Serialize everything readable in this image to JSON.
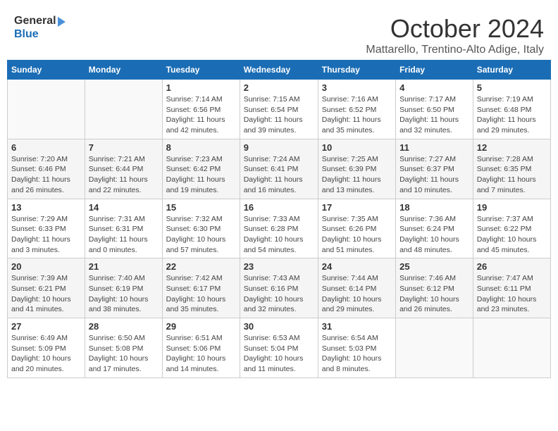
{
  "header": {
    "logo_general": "General",
    "logo_blue": "Blue",
    "month_title": "October 2024",
    "location": "Mattarello, Trentino-Alto Adige, Italy"
  },
  "days_of_week": [
    "Sunday",
    "Monday",
    "Tuesday",
    "Wednesday",
    "Thursday",
    "Friday",
    "Saturday"
  ],
  "weeks": [
    [
      {
        "day": "",
        "info": ""
      },
      {
        "day": "",
        "info": ""
      },
      {
        "day": "1",
        "info": "Sunrise: 7:14 AM\nSunset: 6:56 PM\nDaylight: 11 hours and 42 minutes."
      },
      {
        "day": "2",
        "info": "Sunrise: 7:15 AM\nSunset: 6:54 PM\nDaylight: 11 hours and 39 minutes."
      },
      {
        "day": "3",
        "info": "Sunrise: 7:16 AM\nSunset: 6:52 PM\nDaylight: 11 hours and 35 minutes."
      },
      {
        "day": "4",
        "info": "Sunrise: 7:17 AM\nSunset: 6:50 PM\nDaylight: 11 hours and 32 minutes."
      },
      {
        "day": "5",
        "info": "Sunrise: 7:19 AM\nSunset: 6:48 PM\nDaylight: 11 hours and 29 minutes."
      }
    ],
    [
      {
        "day": "6",
        "info": "Sunrise: 7:20 AM\nSunset: 6:46 PM\nDaylight: 11 hours and 26 minutes."
      },
      {
        "day": "7",
        "info": "Sunrise: 7:21 AM\nSunset: 6:44 PM\nDaylight: 11 hours and 22 minutes."
      },
      {
        "day": "8",
        "info": "Sunrise: 7:23 AM\nSunset: 6:42 PM\nDaylight: 11 hours and 19 minutes."
      },
      {
        "day": "9",
        "info": "Sunrise: 7:24 AM\nSunset: 6:41 PM\nDaylight: 11 hours and 16 minutes."
      },
      {
        "day": "10",
        "info": "Sunrise: 7:25 AM\nSunset: 6:39 PM\nDaylight: 11 hours and 13 minutes."
      },
      {
        "day": "11",
        "info": "Sunrise: 7:27 AM\nSunset: 6:37 PM\nDaylight: 11 hours and 10 minutes."
      },
      {
        "day": "12",
        "info": "Sunrise: 7:28 AM\nSunset: 6:35 PM\nDaylight: 11 hours and 7 minutes."
      }
    ],
    [
      {
        "day": "13",
        "info": "Sunrise: 7:29 AM\nSunset: 6:33 PM\nDaylight: 11 hours and 3 minutes."
      },
      {
        "day": "14",
        "info": "Sunrise: 7:31 AM\nSunset: 6:31 PM\nDaylight: 11 hours and 0 minutes."
      },
      {
        "day": "15",
        "info": "Sunrise: 7:32 AM\nSunset: 6:30 PM\nDaylight: 10 hours and 57 minutes."
      },
      {
        "day": "16",
        "info": "Sunrise: 7:33 AM\nSunset: 6:28 PM\nDaylight: 10 hours and 54 minutes."
      },
      {
        "day": "17",
        "info": "Sunrise: 7:35 AM\nSunset: 6:26 PM\nDaylight: 10 hours and 51 minutes."
      },
      {
        "day": "18",
        "info": "Sunrise: 7:36 AM\nSunset: 6:24 PM\nDaylight: 10 hours and 48 minutes."
      },
      {
        "day": "19",
        "info": "Sunrise: 7:37 AM\nSunset: 6:22 PM\nDaylight: 10 hours and 45 minutes."
      }
    ],
    [
      {
        "day": "20",
        "info": "Sunrise: 7:39 AM\nSunset: 6:21 PM\nDaylight: 10 hours and 41 minutes."
      },
      {
        "day": "21",
        "info": "Sunrise: 7:40 AM\nSunset: 6:19 PM\nDaylight: 10 hours and 38 minutes."
      },
      {
        "day": "22",
        "info": "Sunrise: 7:42 AM\nSunset: 6:17 PM\nDaylight: 10 hours and 35 minutes."
      },
      {
        "day": "23",
        "info": "Sunrise: 7:43 AM\nSunset: 6:16 PM\nDaylight: 10 hours and 32 minutes."
      },
      {
        "day": "24",
        "info": "Sunrise: 7:44 AM\nSunset: 6:14 PM\nDaylight: 10 hours and 29 minutes."
      },
      {
        "day": "25",
        "info": "Sunrise: 7:46 AM\nSunset: 6:12 PM\nDaylight: 10 hours and 26 minutes."
      },
      {
        "day": "26",
        "info": "Sunrise: 7:47 AM\nSunset: 6:11 PM\nDaylight: 10 hours and 23 minutes."
      }
    ],
    [
      {
        "day": "27",
        "info": "Sunrise: 6:49 AM\nSunset: 5:09 PM\nDaylight: 10 hours and 20 minutes."
      },
      {
        "day": "28",
        "info": "Sunrise: 6:50 AM\nSunset: 5:08 PM\nDaylight: 10 hours and 17 minutes."
      },
      {
        "day": "29",
        "info": "Sunrise: 6:51 AM\nSunset: 5:06 PM\nDaylight: 10 hours and 14 minutes."
      },
      {
        "day": "30",
        "info": "Sunrise: 6:53 AM\nSunset: 5:04 PM\nDaylight: 10 hours and 11 minutes."
      },
      {
        "day": "31",
        "info": "Sunrise: 6:54 AM\nSunset: 5:03 PM\nDaylight: 10 hours and 8 minutes."
      },
      {
        "day": "",
        "info": ""
      },
      {
        "day": "",
        "info": ""
      }
    ]
  ]
}
